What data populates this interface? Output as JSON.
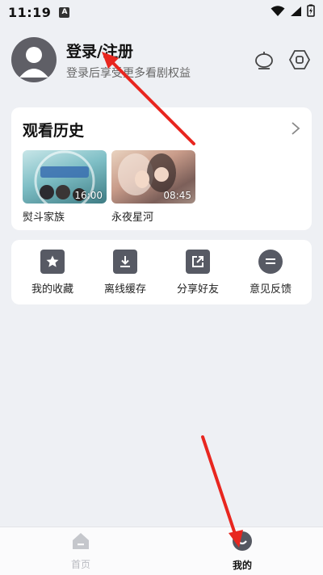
{
  "status_bar": {
    "time": "11:19",
    "app_badge": "A"
  },
  "profile": {
    "login_label": "登录/注册",
    "subtitle": "登录后享受更多看剧权益"
  },
  "history": {
    "title": "观看历史",
    "items": [
      {
        "name": "熨斗家族",
        "duration": "16:00"
      },
      {
        "name": "永夜星河",
        "duration": "08:45"
      }
    ]
  },
  "actions": [
    {
      "label": "我的收藏",
      "icon": "star-icon"
    },
    {
      "label": "离线缓存",
      "icon": "download-icon"
    },
    {
      "label": "分享好友",
      "icon": "share-icon"
    },
    {
      "label": "意见反馈",
      "icon": "feedback-icon"
    }
  ],
  "tabbar": {
    "home_label": "首页",
    "mine_label": "我的"
  },
  "colors": {
    "annotation_arrow": "#e8261f",
    "icon_gray": "#575a64"
  }
}
